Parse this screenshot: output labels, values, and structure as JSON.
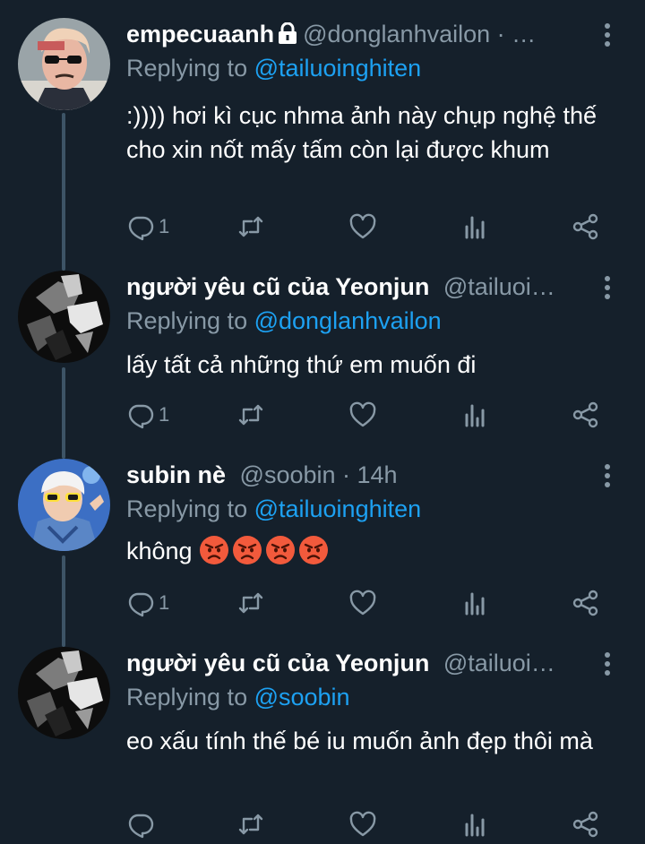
{
  "tweets": [
    {
      "name": "empecuaanh",
      "handle": "@donglanhvailon · …",
      "locked": true,
      "replying_label": "Replying to ",
      "replying_to": "@tailuoinghiten",
      "text": ":)))) hơi kì cục nhma ảnh này chụp nghệ thế cho xin nốt mấy tấm còn lại được khum",
      "reply_count": "1"
    },
    {
      "name": "người yêu cũ của Yeonjun",
      "handle": "@tailuoi…",
      "replying_label": "Replying to ",
      "replying_to": "@donglanhvailon",
      "text": "lấy tất cả những thứ em muốn đi",
      "reply_count": "1"
    },
    {
      "name": "subin nè",
      "handle": "@soobin · 14h",
      "replying_label": "Replying to ",
      "replying_to": "@tailuoinghiten",
      "text": "không",
      "emoji": [
        "angry-face",
        "angry-face",
        "angry-face",
        "angry-face"
      ],
      "reply_count": "1"
    },
    {
      "name": "người yêu cũ của Yeonjun",
      "handle": "@tailuoi…",
      "replying_label": "Replying to ",
      "replying_to": "@soobin",
      "text": "eo xấu tính thế bé iu muốn ảnh đẹp thôi mà",
      "reply_count": ""
    }
  ],
  "icons": {
    "reply": "reply-icon",
    "retweet": "retweet-icon",
    "like": "heart-icon",
    "analytics": "analytics-icon",
    "share": "share-icon",
    "more": "more-vertical-icon",
    "lock": "lock-icon"
  },
  "colors": {
    "background": "#15202b",
    "secondary_text": "#8899a6",
    "mention": "#1da1f2",
    "thread_line": "#3d5466"
  }
}
